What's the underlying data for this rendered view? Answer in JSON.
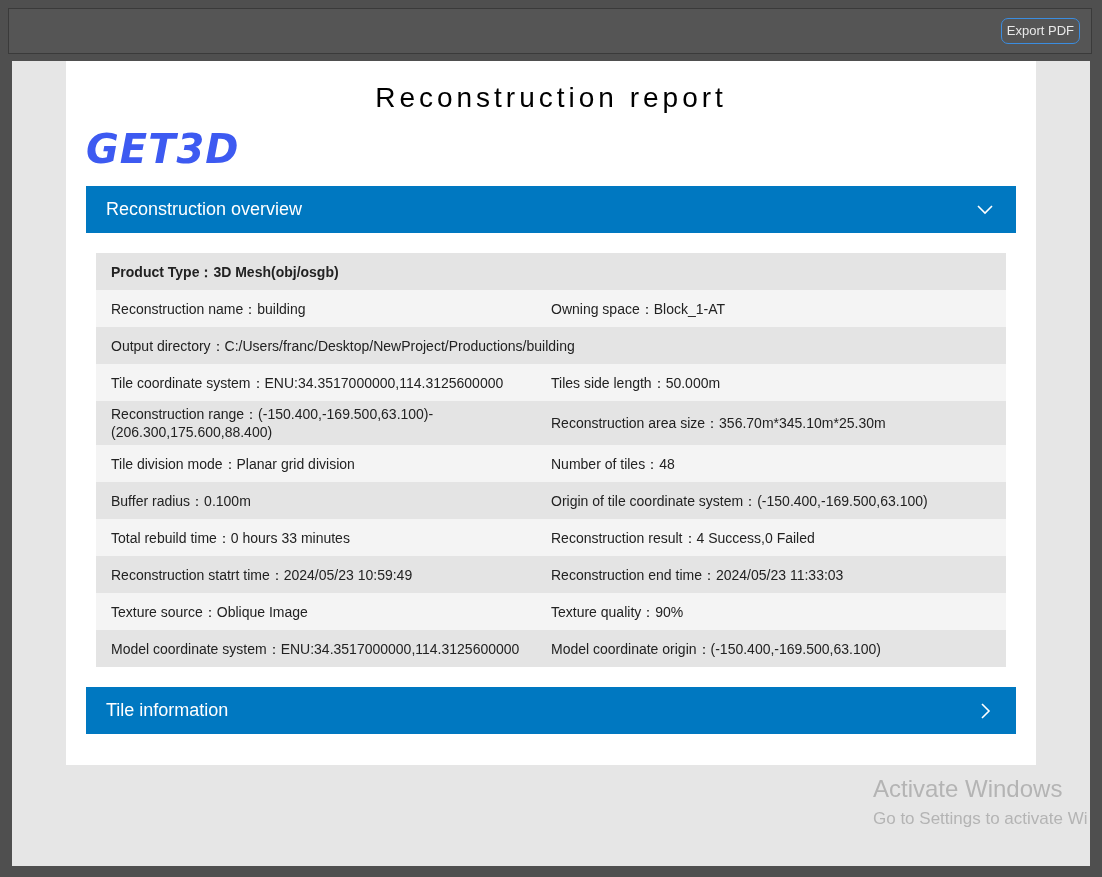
{
  "toolbar": {
    "export_button": "Export PDF"
  },
  "report": {
    "title": "Reconstruction report",
    "logo": "GET3D",
    "sections": [
      {
        "title": "Reconstruction overview",
        "expanded": true,
        "rows": [
          {
            "kind": "header",
            "cells": [
              "Product Type：3D Mesh(obj/osgb)"
            ]
          },
          {
            "kind": "pair",
            "cells": [
              "Reconstruction name：building",
              "Owning space：Block_1-AT"
            ]
          },
          {
            "kind": "full",
            "cells": [
              "Output directory：C:/Users/franc/Desktop/NewProject/Productions/building"
            ]
          },
          {
            "kind": "pair",
            "cells": [
              "Tile coordinate system：ENU:34.3517000000,114.3125600000",
              "Tiles side length：50.000m"
            ]
          },
          {
            "kind": "pair",
            "cells": [
              "Reconstruction range：(-150.400,-169.500,63.100)-(206.300,175.600,88.400)",
              "Reconstruction area size：356.70m*345.10m*25.30m"
            ]
          },
          {
            "kind": "pair",
            "cells": [
              "Tile division mode：Planar grid division",
              "Number of tiles：48"
            ]
          },
          {
            "kind": "pair",
            "cells": [
              "Buffer radius：0.100m",
              "Origin of tile coordinate system：(-150.400,-169.500,63.100)"
            ]
          },
          {
            "kind": "pair",
            "cells": [
              "Total rebuild time：0 hours 33 minutes",
              "Reconstruction result：4 Success,0 Failed"
            ]
          },
          {
            "kind": "pair",
            "cells": [
              "Reconstruction statrt time：2024/05/23 10:59:49",
              "Reconstruction end time：2024/05/23 11:33:03"
            ]
          },
          {
            "kind": "pair",
            "cells": [
              "Texture source：Oblique Image",
              "Texture quality：90%"
            ]
          },
          {
            "kind": "pair",
            "cells": [
              "Model coordinate system：ENU:34.3517000000,114.3125600000",
              "Model coordinate origin：(-150.400,-169.500,63.100)"
            ]
          }
        ]
      },
      {
        "title": "Tile information",
        "expanded": false
      }
    ]
  },
  "os_notice": {
    "title": "Activate Windows",
    "subtitle": "Go to Settings to activate Wi"
  }
}
